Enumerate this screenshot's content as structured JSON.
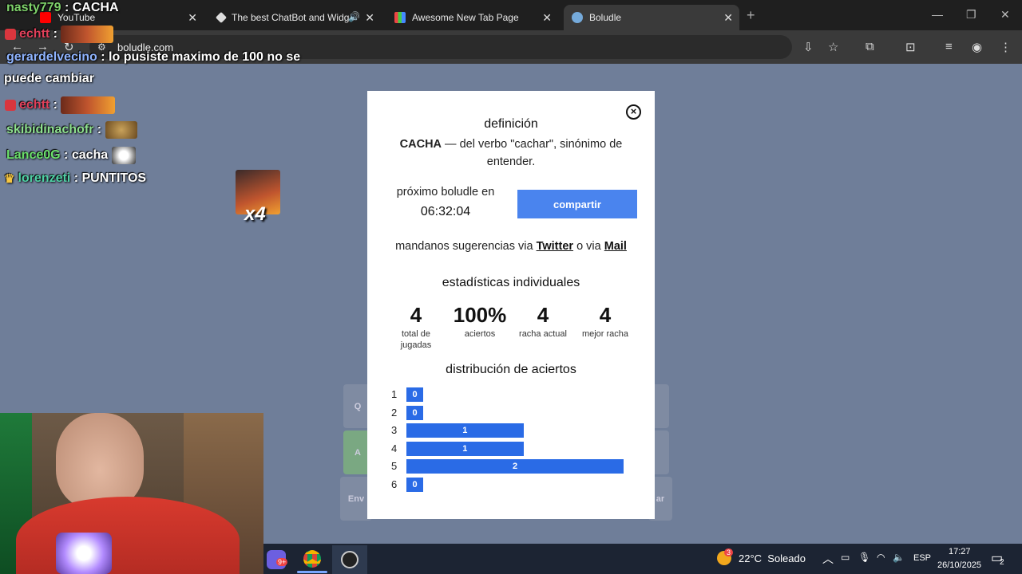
{
  "browser": {
    "tabs": [
      {
        "title": "YouTube"
      },
      {
        "title": "The best ChatBot and Widg"
      },
      {
        "title": "Awesome New Tab Page"
      },
      {
        "title": "Boludle"
      }
    ],
    "url": "boludle.com"
  },
  "chat": [
    {
      "user": "nasty779",
      "sep": " : ",
      "text": "CACHA",
      "user_color": "#7fd36b"
    },
    {
      "user": "echtt",
      "sep": " : ",
      "text": "",
      "user_color": "#e0405a"
    },
    {
      "user": "gerardelvecino",
      "sep": " : ",
      "text": "lo pusiste maximo de 100 no se",
      "user_color": "#8fb4ff"
    },
    {
      "user": "",
      "sep": "",
      "text": "puede cambiar",
      "user_color": "#ffffff"
    },
    {
      "user": "echtt",
      "sep": " : ",
      "text": "",
      "user_color": "#e0405a"
    },
    {
      "user": "skibidinachofr",
      "sep": " : ",
      "text": "",
      "user_color": "#8ee08e"
    },
    {
      "user": "Lance0G",
      "sep": " : ",
      "text": "cacha",
      "user_color": "#6be06b"
    },
    {
      "user": "lorenzeti",
      "sep": " : ",
      "text": "PUNTITOS",
      "user_color": "#4fd1a5"
    }
  ],
  "emote_label": "x4",
  "keyboard": {
    "q": "Q",
    "a": "A",
    "enviar": "Env",
    "borrar": "ar"
  },
  "modal": {
    "definition_title": "definición",
    "word": "CACHA",
    "definition_text": " — del verbo \"cachar\", sinónimo de entender.",
    "next_label": "próximo boludle en",
    "timer": "06:32:04",
    "share_label": "compartir",
    "suggest_prefix": "mandanos sugerencias via ",
    "twitter_label": "Twitter",
    "suggest_mid": " o via ",
    "mail_label": "Mail",
    "stats_title": "estadísticas individuales",
    "stats": [
      {
        "value": "4",
        "label": "total de jugadas"
      },
      {
        "value": "100%",
        "label": "aciertos"
      },
      {
        "value": "4",
        "label": "racha actual"
      },
      {
        "value": "4",
        "label": "mejor racha"
      }
    ],
    "distribution_title": "distribución de aciertos",
    "distribution": [
      {
        "guess": "1",
        "count": 0
      },
      {
        "guess": "2",
        "count": 0
      },
      {
        "guess": "3",
        "count": 1
      },
      {
        "guess": "4",
        "count": 1
      },
      {
        "guess": "5",
        "count": 2
      },
      {
        "guess": "6",
        "count": 0
      }
    ]
  },
  "taskbar": {
    "notification_badge": "9+",
    "weather_badge": "3",
    "weather": "22°C  Soleado",
    "lang": "ESP",
    "time": "17:27",
    "date": "26/10/2025",
    "notif_count": "2"
  },
  "colors": {
    "accent": "#4a84ee",
    "bar": "#2a6be6",
    "background": "#6f7e99"
  }
}
